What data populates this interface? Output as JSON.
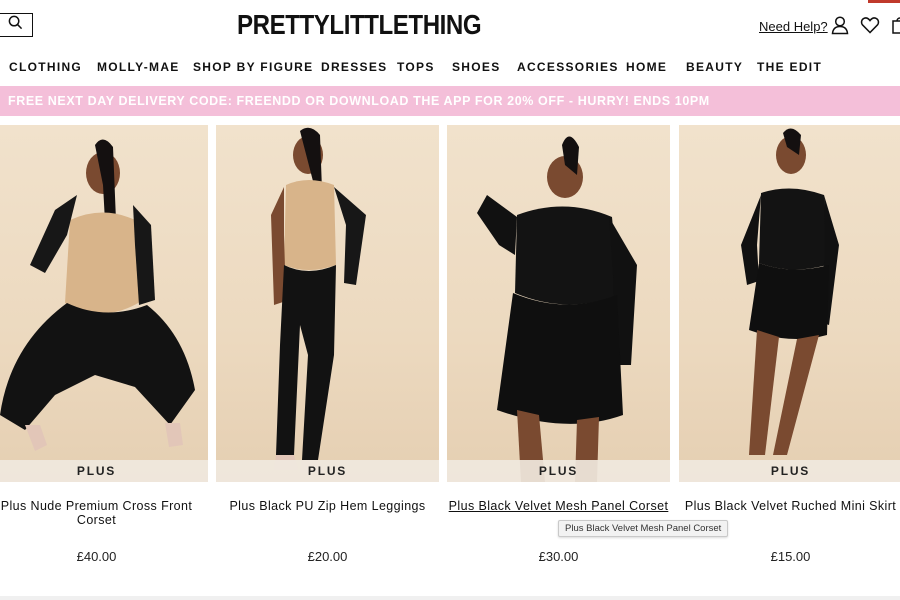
{
  "header": {
    "logo": "PRETTYLITTLETHING",
    "need_help": "Need Help?",
    "icons": [
      "search-icon",
      "account-icon",
      "heart-icon",
      "bag-icon"
    ]
  },
  "nav": {
    "items": [
      "CLOTHING",
      "MOLLY-MAE",
      "SHOP BY FIGURE",
      "DRESSES",
      "TOPS",
      "SHOES",
      "ACCESSORIES",
      "HOME",
      "BEAUTY",
      "THE EDIT"
    ]
  },
  "promo": {
    "text": "FREE NEXT DAY DELIVERY CODE: FREENDD OR DOWNLOAD THE APP FOR 20% OFF - HURRY! ENDS 10PM",
    "background": "#f4bfd9"
  },
  "products": [
    {
      "badge": "PLUS",
      "name": "Plus Nude Premium Cross Front Corset",
      "price": "£40.00"
    },
    {
      "badge": "PLUS",
      "name": "Plus Black PU Zip Hem Leggings",
      "price": "£20.00"
    },
    {
      "badge": "PLUS",
      "name": "Plus Black Velvet Mesh Panel Corset",
      "price": "£30.00"
    },
    {
      "badge": "PLUS",
      "name": "Plus Black Velvet Ruched Mini Skirt",
      "price": "£15.00"
    }
  ],
  "tooltip": {
    "text": "Plus Black Velvet Mesh Panel Corset"
  }
}
